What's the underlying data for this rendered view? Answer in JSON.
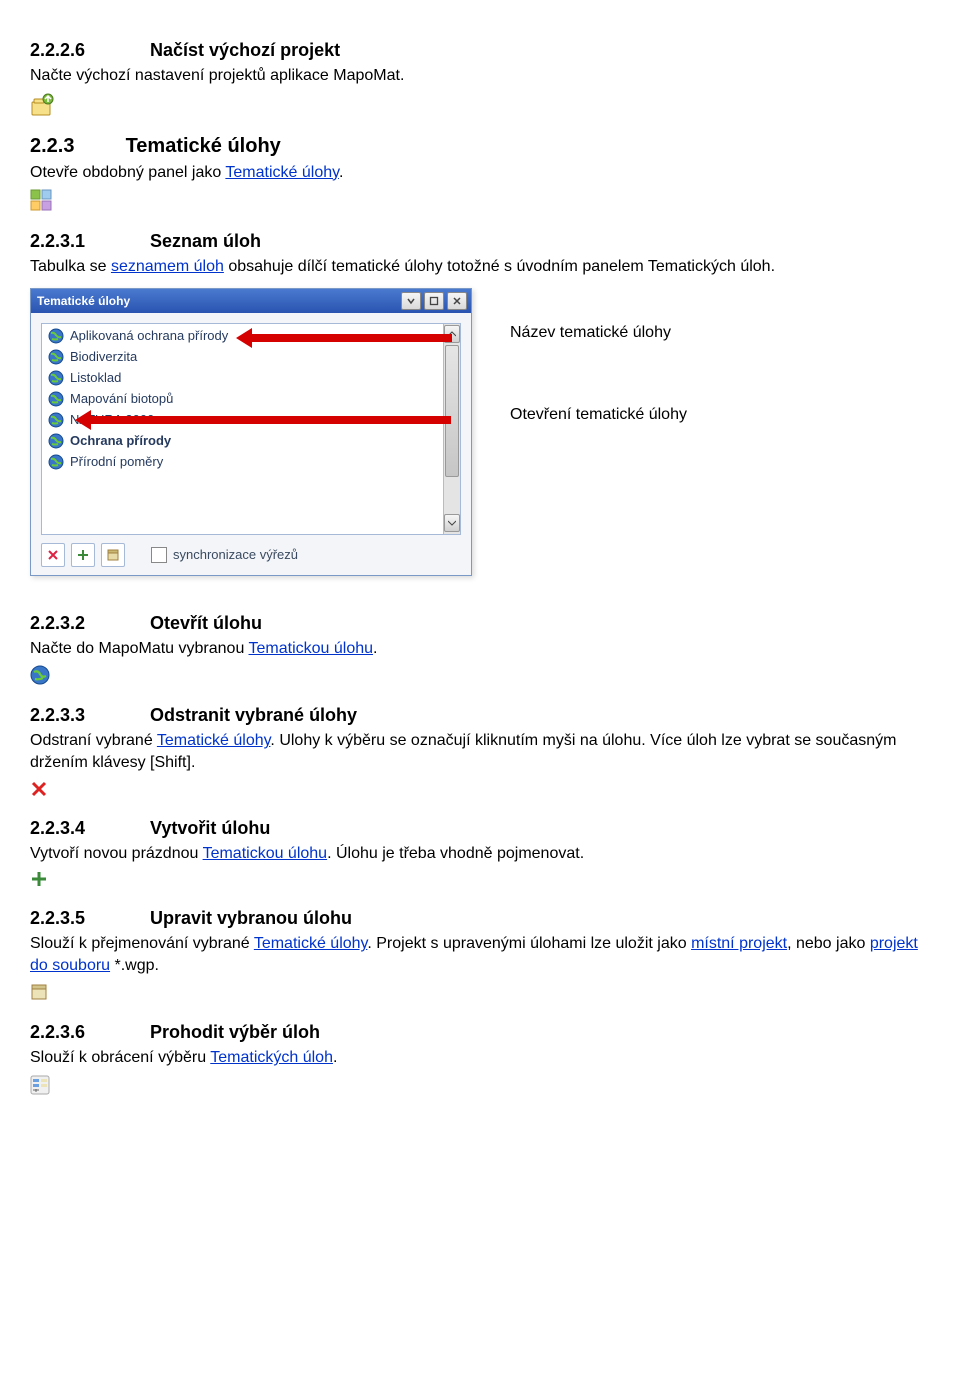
{
  "sections": {
    "s226": {
      "num": "2.2.2.6",
      "title": "Načíst výchozí projekt",
      "body_pre": "Načte výchozí nastavení projektů aplikace MapoMat."
    },
    "s223": {
      "num": "2.2.3",
      "title": "Tematické úlohy",
      "body_pre": "Otevře obdobný panel jako ",
      "link": "Tematické úlohy",
      "body_post": "."
    },
    "s2231": {
      "num": "2.2.3.1",
      "title": "Seznam úloh",
      "body": {
        "pre": "Tabulka se ",
        "link1": "seznamem úloh",
        "mid": " obsahuje dílčí tematické úlohy totožné s úvodním panelem Tematických úloh."
      }
    },
    "s2232": {
      "num": "2.2.3.2",
      "title": "Otevřít úlohu",
      "body_pre": "Načte do MapoMatu vybranou ",
      "link": "Tematickou úlohu",
      "body_post": "."
    },
    "s2233": {
      "num": "2.2.3.3",
      "title": "Odstranit vybrané úlohy",
      "body_pre": "Odstraní vybrané ",
      "link": "Tematické úlohy",
      "body_post": ". Ulohy k výběru se označují kliknutím myši na úlohu. Více úloh lze vybrat se současným držením klávesy [Shift]."
    },
    "s2234": {
      "num": "2.2.3.4",
      "title": "Vytvořit úlohu",
      "body_pre": "Vytvoří novou prázdnou ",
      "link": "Tematickou úlohu",
      "body_post": ". Úlohu je třeba vhodně pojmenovat."
    },
    "s2235": {
      "num": "2.2.3.5",
      "title": "Upravit vybranou úlohu",
      "body_pre": "Slouží k přejmenování vybrané ",
      "link": "Tematické úlohy",
      "mid": ". Projekt s upravenými úlohami lze uložit jako ",
      "link2": "místní projekt",
      "mid2": ", nebo jako ",
      "link3": "projekt do souboru",
      "post": " *.wgp."
    },
    "s2236": {
      "num": "2.2.3.6",
      "title": "Prohodit výběr úloh",
      "body_pre": "Slouží k obrácení výběru ",
      "link": "Tematických úloh",
      "body_post": "."
    }
  },
  "panel": {
    "title": "Tematické úlohy",
    "items": [
      {
        "label": "Aplikovaná ochrana přírody"
      },
      {
        "label": "Biodiverzita"
      },
      {
        "label": "Listoklad"
      },
      {
        "label": "Mapování biotopů"
      },
      {
        "label": "NATURA 2000"
      },
      {
        "label": "Ochrana přírody"
      },
      {
        "label": "Přírodní poměry"
      }
    ],
    "sync_label": "synchronizace výřezů"
  },
  "callouts": {
    "name": "Název tematické úlohy",
    "open": "Otevření tematické úlohy"
  }
}
